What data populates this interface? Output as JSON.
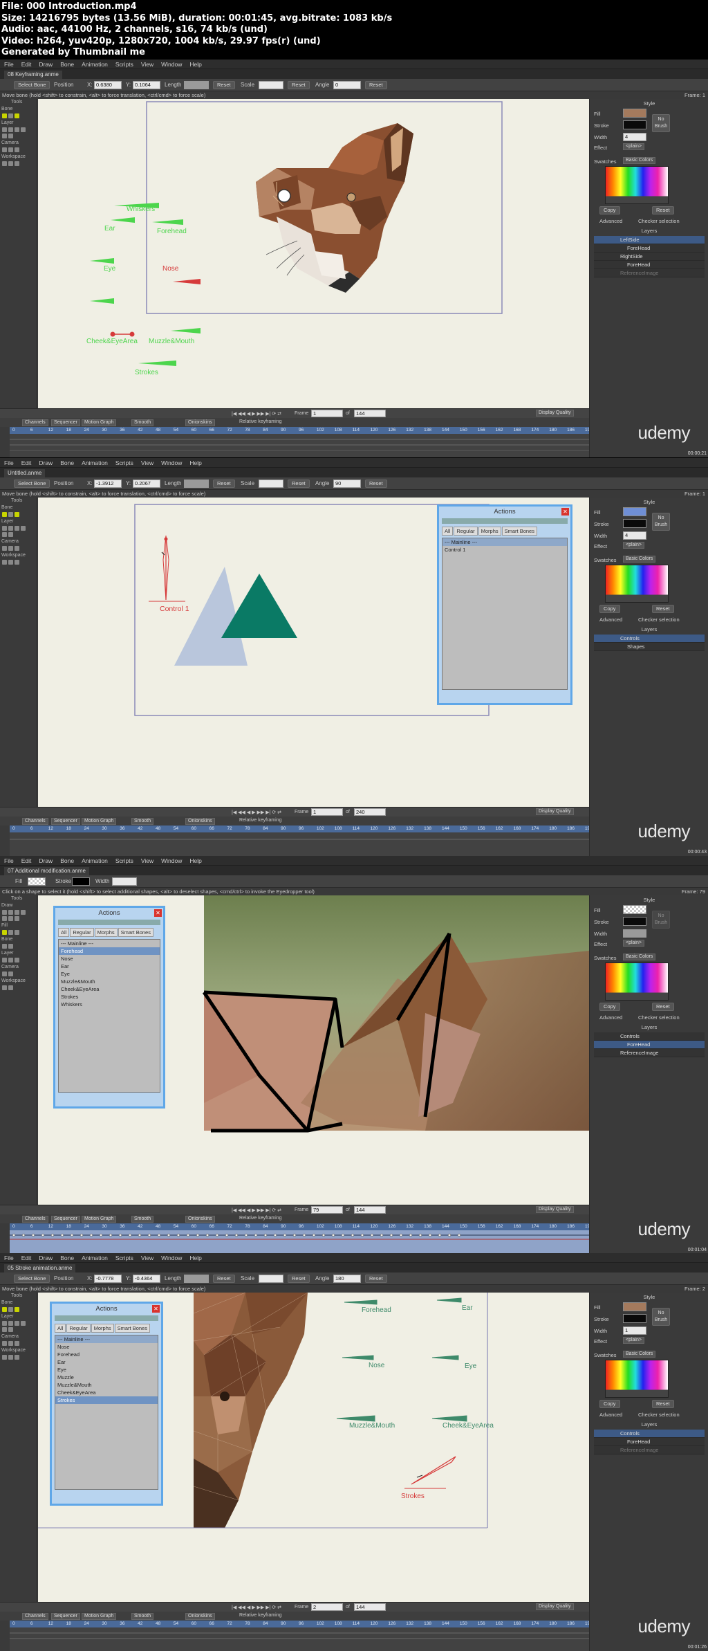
{
  "header": {
    "file": "File: 000 Introduction.mp4",
    "size": "Size: 14216795 bytes (13.56 MiB), duration: 00:01:45, avg.bitrate: 1083 kb/s",
    "audio": "Audio: aac, 44100 Hz, 2 channels, s16, 74 kb/s (und)",
    "video": "Video: h264, yuv420p, 1280x720, 1004 kb/s, 29.97 fps(r) (und)",
    "generator": "Generated by Thumbnail me"
  },
  "menu": [
    "File",
    "Edit",
    "Draw",
    "Bone",
    "Animation",
    "Scripts",
    "View",
    "Window",
    "Help"
  ],
  "common": {
    "reset": "Reset",
    "scale": "Scale",
    "angle": "Angle",
    "position": "Position",
    "x": "X:",
    "y": "Y:",
    "length": "Length",
    "select_bone": "Select Bone",
    "tools": "Tools",
    "bone": "Bone",
    "layer": "Layer",
    "camera": "Camera",
    "workspace": "Workspace",
    "style": "Style",
    "fill": "Fill",
    "stroke": "Stroke",
    "width": "Width",
    "effect": "Effect",
    "effect_val": "<plain>",
    "no_brush": "No Brush",
    "swatches": "Swatches",
    "swatch_set": "Basic Colors",
    "copy": "Copy",
    "advanced": "Advanced",
    "checker": "Checker selection",
    "layers": "Layers",
    "frame": "Frame",
    "of": "of",
    "display_quality": "Display Quality",
    "tl_tabs": [
      "Channels",
      "Sequencer",
      "Motion Graph"
    ],
    "smooth": "Smooth",
    "onionskins": "Onionskins",
    "relative": "Relative keyframing",
    "ruler": [
      "0",
      "6",
      "12",
      "18",
      "24",
      "30",
      "36",
      "42",
      "48",
      "54",
      "60",
      "66",
      "72",
      "78",
      "84",
      "90",
      "96",
      "102",
      "108",
      "114",
      "120",
      "126",
      "132",
      "138",
      "144",
      "150",
      "156",
      "162",
      "168",
      "174",
      "180",
      "186",
      "192"
    ],
    "watermark": "udemy",
    "actions_title": "Actions",
    "actions_tabs": [
      "All",
      "Regular",
      "Morphs",
      "Smart Bones"
    ],
    "mainline": "--- Mainline ---"
  },
  "frames": [
    {
      "tab": "08 Keyframing.anme",
      "status": "Move bone (hold <shift> to constrain, <alt> to force translation, <ctrl/cmd> to force scale)",
      "frame_lbl": "Frame: 1",
      "pos_x": "0.6380",
      "pos_y": "0.1064",
      "angle": "0",
      "frame": "1",
      "total": "144",
      "timestamp": "00:00:21",
      "layers": [
        "LeftSide",
        "ForeHead",
        "RightSide",
        "ForeHead",
        "ReferenceImage"
      ],
      "bones": [
        "Whiskers",
        "Ear",
        "Forehead",
        "Eye",
        "Nose",
        "Cheek&EyeArea",
        "Muzzle&Mouth",
        "Strokes"
      ]
    },
    {
      "tab": "Untitled.anme",
      "status": "Move bone (hold <shift> to constrain, <alt> to force translation, <ctrl/cmd> to force scale)",
      "frame_lbl": "Frame: 1",
      "pos_x": "-1.3912",
      "pos_y": "0.2067",
      "angle": "90",
      "frame": "1",
      "total": "240",
      "timestamp": "00:00:43",
      "layers": [
        "Controls",
        "Shapes"
      ],
      "control": "Control 1",
      "actions": [
        "Control 1"
      ]
    },
    {
      "tab": "07 Additional modification.anme",
      "status": "Click on a shape to select it (hold <shift> to select additional shapes, <alt> to deselect shapes, <cmd/ctrl> to invoke the Eyedropper tool)",
      "frame_lbl": "Frame: 79",
      "stroke_w": "Width",
      "frame": "79",
      "total": "144",
      "timestamp": "00:01:04",
      "layers": [
        "Controls",
        "ForeHead",
        "ReferenceImage"
      ],
      "actions": [
        "Forehead",
        "Nose",
        "Ear",
        "Eye",
        "Muzzle&Mouth",
        "Cheek&EyeArea",
        "Strokes",
        "Whiskers"
      ],
      "tools_extra": [
        "Draw",
        "Fill"
      ]
    },
    {
      "tab": "05 Stroke animation.anme",
      "status": "Move bone (hold <shift> to constrain, <alt> to force translation, <ctrl/cmd> to force scale)",
      "frame_lbl": "Frame: 2",
      "pos_x": "-0.7778",
      "pos_y": "-0.4364",
      "angle": "180",
      "frame": "2",
      "total": "144",
      "timestamp": "00:01:26",
      "layers": [
        "Controls",
        "ForeHead",
        "ReferenceImage"
      ],
      "actions": [
        "Nose",
        "Forehead",
        "Ear",
        "Eye",
        "Muzzle",
        "Muzzle&Mouth",
        "Cheek&EyeArea",
        "Strokes"
      ],
      "bones": [
        "Forehead",
        "Ear",
        "Nose",
        "Eye",
        "Muzzle&Mouth",
        "Cheek&EyeArea",
        "Strokes"
      ]
    }
  ],
  "colors": {
    "bone_green": "#4cd54c",
    "bone_red": "#d63a3a",
    "canvas_bg": "#f0efe4",
    "dialog_border": "#5fa7e8",
    "timeline_blue": "#4a6a9a"
  }
}
